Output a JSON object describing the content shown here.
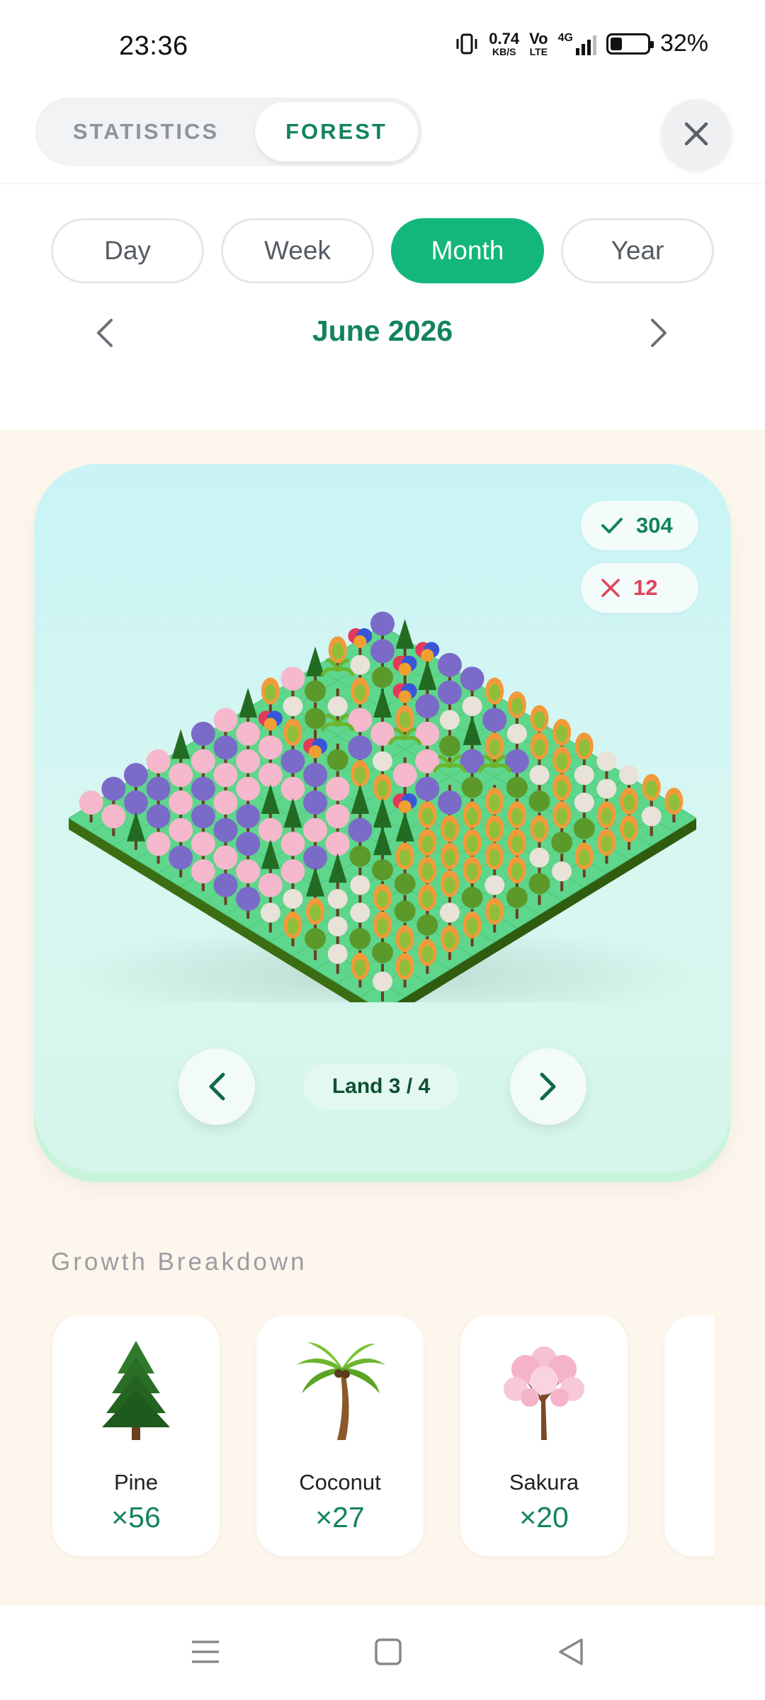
{
  "status_bar": {
    "time": "23:36",
    "net_speed_value": "0.74",
    "net_speed_unit": "KB/S",
    "volte_top": "Vo",
    "volte_bottom": "LTE",
    "network": "4G",
    "battery": "32%",
    "battery_level_percent": 32
  },
  "header": {
    "tabs": [
      {
        "label": "STATISTICS",
        "active": false
      },
      {
        "label": "FOREST",
        "active": true
      }
    ],
    "close_icon": "close-icon"
  },
  "period": {
    "options": [
      {
        "label": "Day",
        "active": false
      },
      {
        "label": "Week",
        "active": false
      },
      {
        "label": "Month",
        "active": true
      },
      {
        "label": "Year",
        "active": false
      }
    ],
    "current": "June 2026"
  },
  "forest": {
    "success_count": "304",
    "failed_count": "12",
    "land_label": "Land 3 / 4"
  },
  "growth_breakdown": {
    "title": "Growth Breakdown",
    "items": [
      {
        "name": "Pine",
        "count": "×56"
      },
      {
        "name": "Coconut",
        "count": "×27"
      },
      {
        "name": "Sakura",
        "count": "×20"
      }
    ]
  },
  "colors": {
    "accent": "#13b77b",
    "accent_dark": "#13845a",
    "fail": "#e0435b",
    "background": "#fcf6ec"
  }
}
